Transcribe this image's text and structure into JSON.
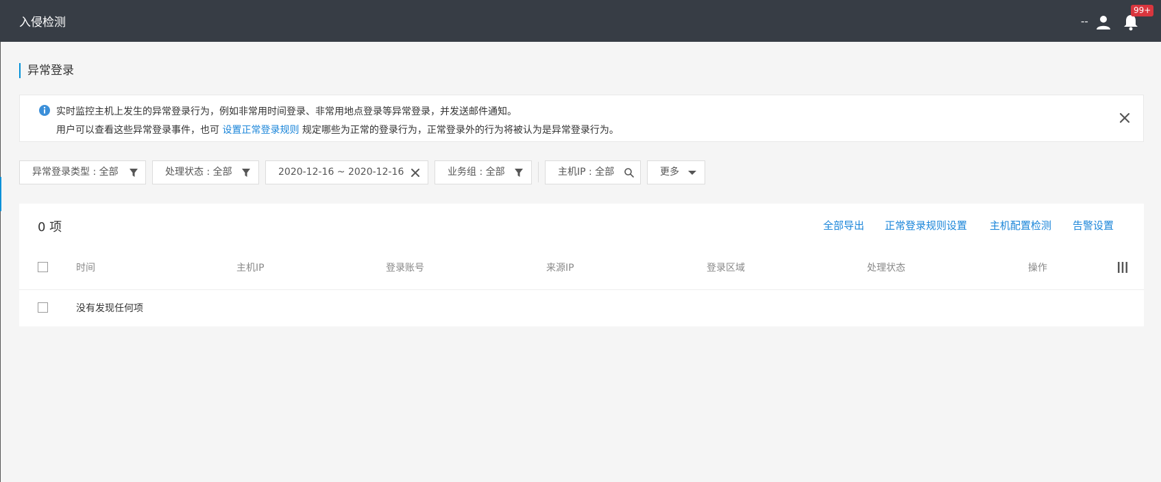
{
  "header": {
    "title": "入侵检测",
    "user_text": "--",
    "notification_badge": "99+"
  },
  "page": {
    "title": "异常登录"
  },
  "info": {
    "line1": "实时监控主机上发生的异常登录行为，例如非常用时间登录、非常用地点登录等异常登录，并发送邮件通知。",
    "line2_prefix": "用户可以查看这些异常登录事件，也可",
    "line2_link": "设置正常登录规则",
    "line2_suffix": "规定哪些为正常的登录行为，正常登录外的行为将被认为是异常登录行为。"
  },
  "filters": {
    "type": "异常登录类型 : 全部",
    "status": "处理状态 : 全部",
    "date_range": "2020-12-16 ~ 2020-12-16",
    "business_group": "业务组 : 全部",
    "host_ip": "主机IP : 全部",
    "more": "更多"
  },
  "table": {
    "count": "0 项",
    "actions": {
      "export_all": "全部导出",
      "login_rules": "正常登录规则设置",
      "host_config": "主机配置检测",
      "alert_settings": "告警设置"
    },
    "columns": [
      "时间",
      "主机IP",
      "登录账号",
      "来源IP",
      "登录区域",
      "处理状态",
      "操作"
    ],
    "empty_text": "没有发现任何项"
  },
  "colors": {
    "topbar": "#373d45",
    "accent": "#0090d8",
    "link": "#1a85d9",
    "badge": "#d9363e"
  },
  "icons": [
    "user-icon",
    "bell-icon",
    "info-icon",
    "close-icon",
    "filter-icon",
    "search-icon",
    "caret-down-icon",
    "column-settings-icon"
  ]
}
